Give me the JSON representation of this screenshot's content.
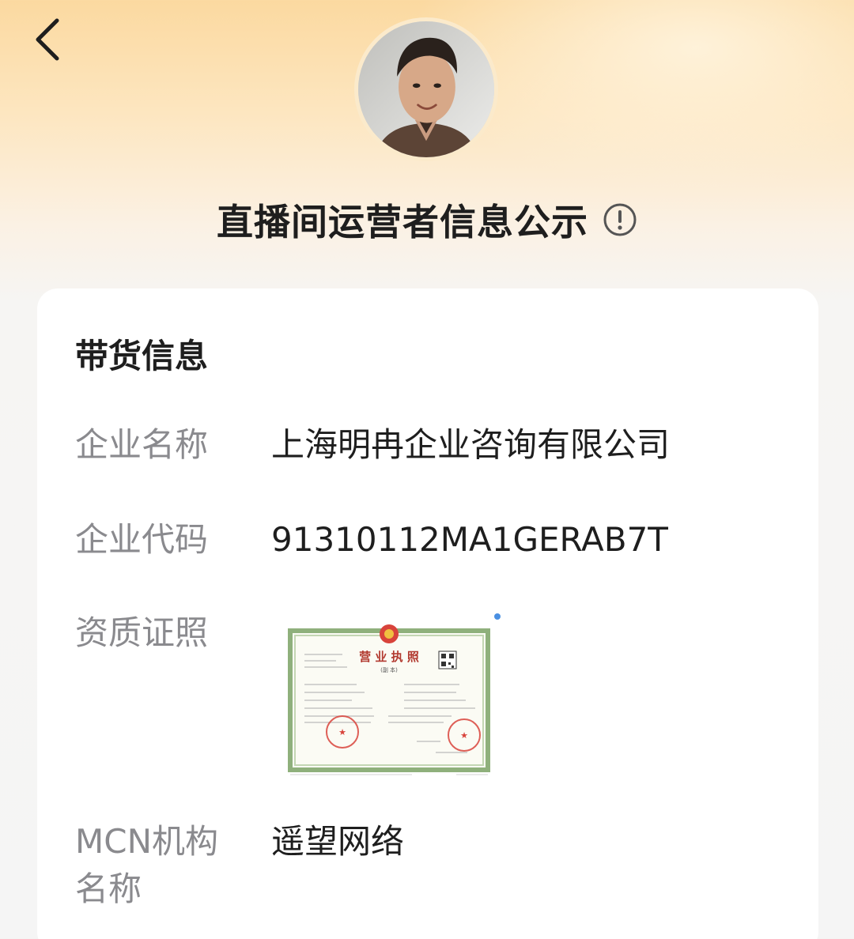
{
  "header": {
    "back_icon": "chevron-left-icon",
    "title": "直播间运营者信息公示",
    "info_icon": "exclamation-circle-icon"
  },
  "card": {
    "section_title": "带货信息",
    "rows": [
      {
        "label": "企业名称",
        "value": "上海明冉企业咨询有限公司"
      },
      {
        "label": "企业代码",
        "value": "91310112MA1GERAB7T"
      },
      {
        "label": "资质证照",
        "value": ""
      },
      {
        "label": "MCN机构名称",
        "value": "遥望网络"
      }
    ],
    "license_image": {
      "title": "营 业 执 照",
      "subtitle": "(副 本)"
    }
  },
  "colors": {
    "background_top": "#fbd9a0",
    "background_bottom": "#f5f5f5",
    "label_gray": "#8a8a8e",
    "text_dark": "#1e1e1e",
    "seal_red": "#d8433b",
    "cert_border_green": "#8fb07c"
  }
}
